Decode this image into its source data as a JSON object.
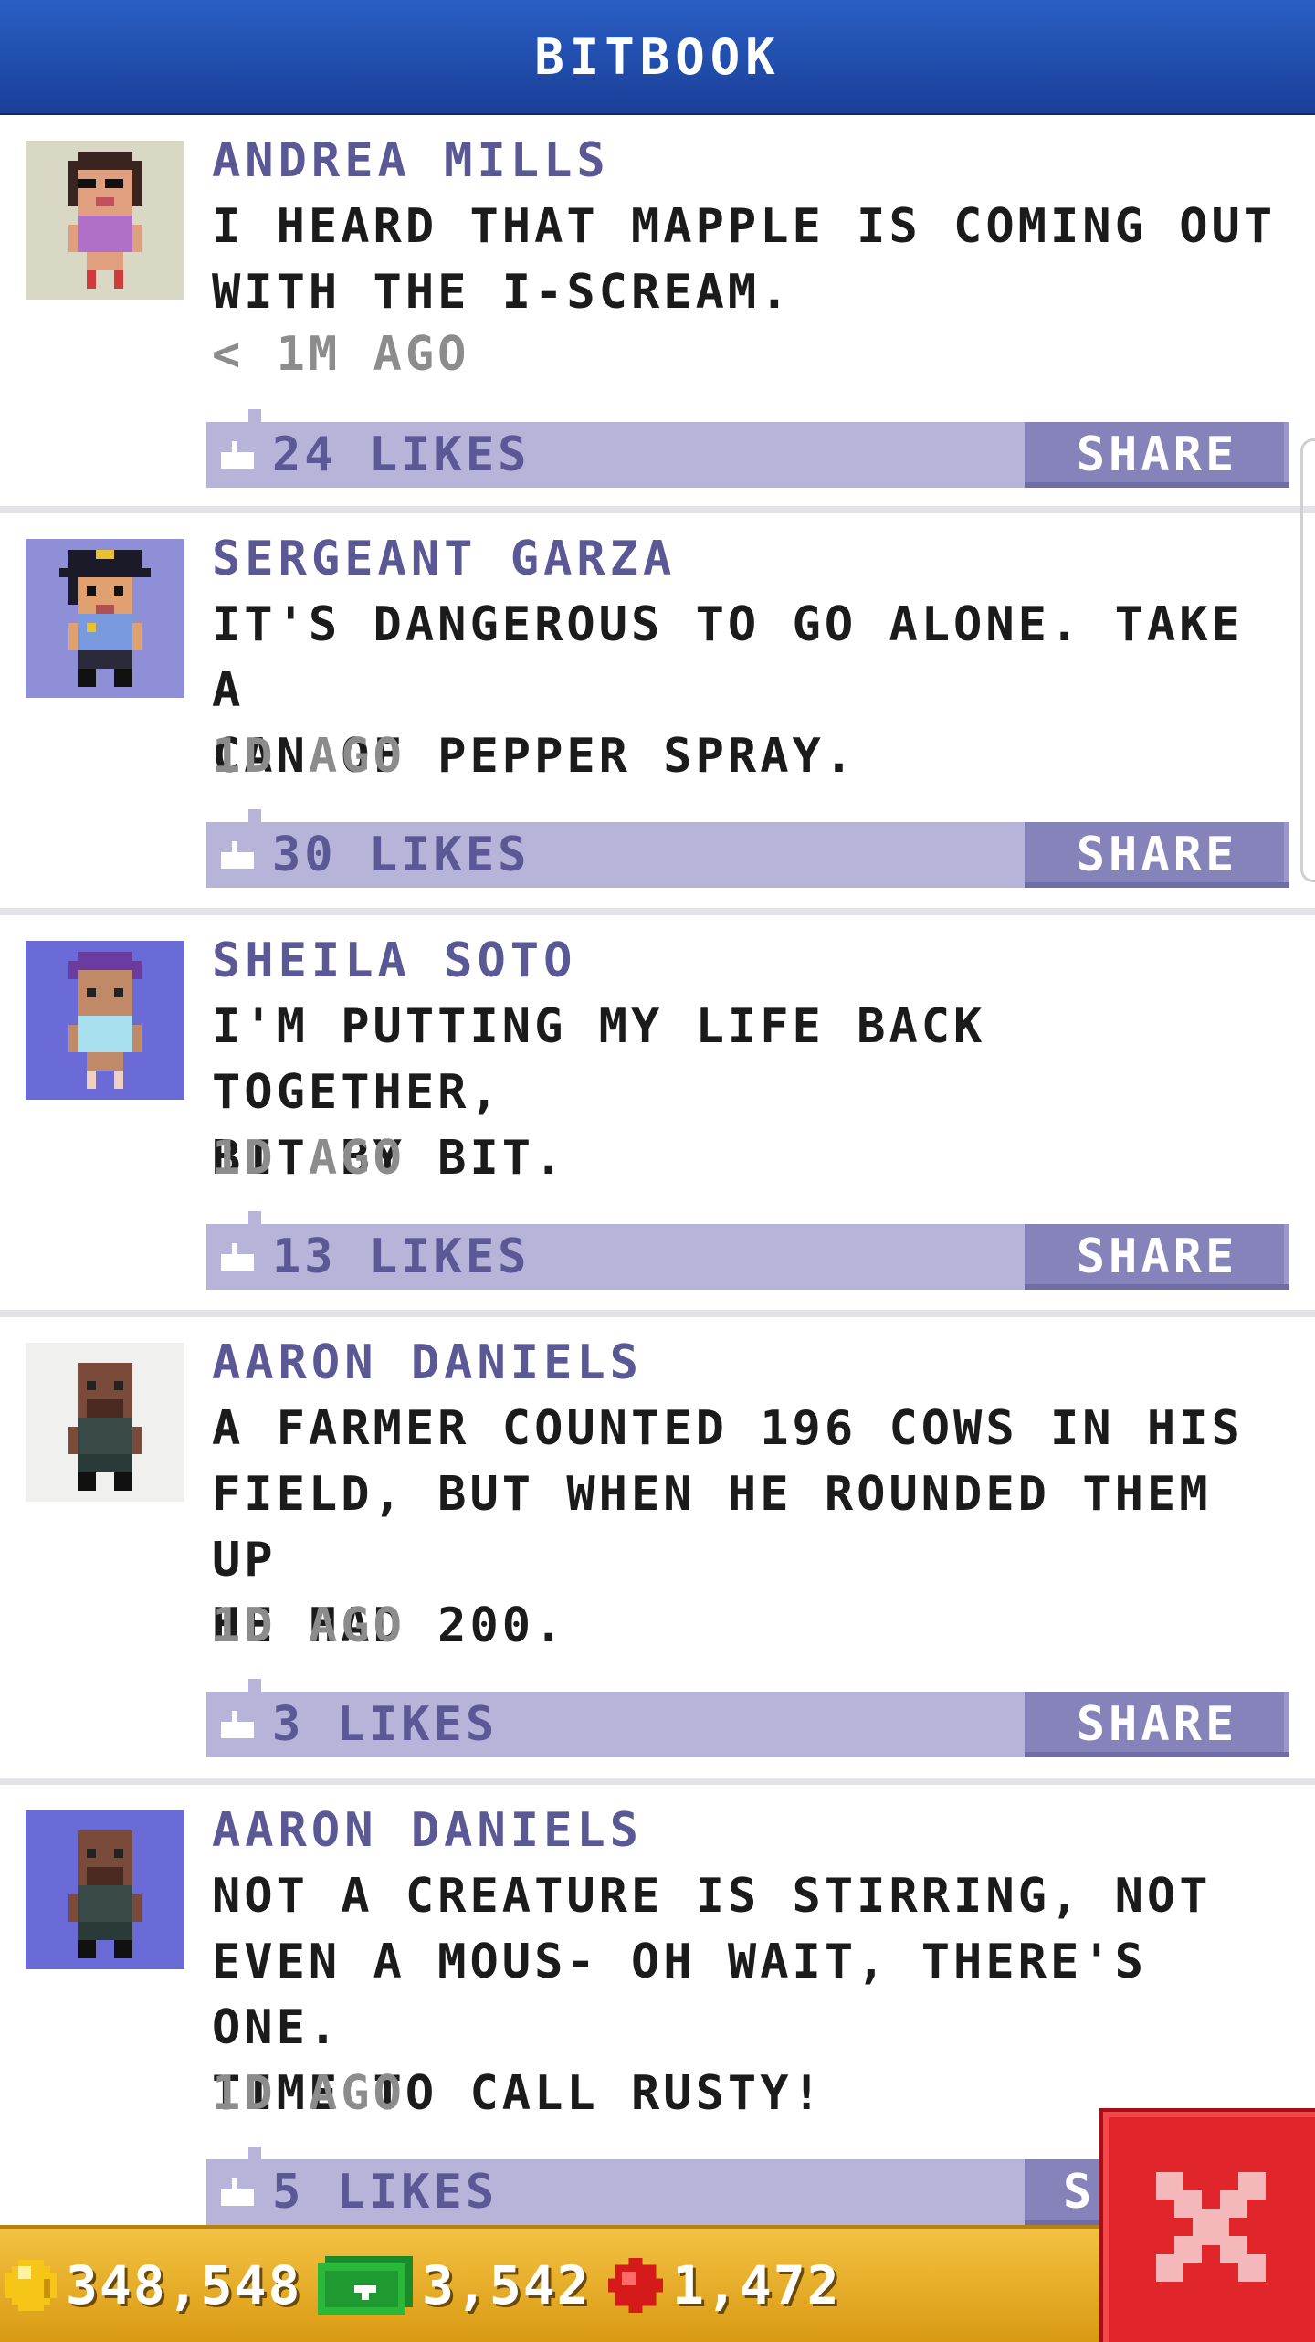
{
  "header": {
    "title": "BITBOOK"
  },
  "posts": [
    {
      "name": "ANDREA MILLS",
      "message": "I HEARD THAT MAPPLE IS COMING OUT\nWITH THE I-SCREAM.",
      "time": "< 1M AGO",
      "likes": "24 LIKES",
      "share": "SHARE",
      "avatar_bg": "#d8d8c4"
    },
    {
      "name": "SERGEANT GARZA",
      "message": "IT'S DANGEROUS TO GO ALONE. TAKE A\nCAN OF PEPPER SPRAY.",
      "time": "1D AGO",
      "likes": "30 LIKES",
      "share": "SHARE",
      "avatar_bg": "#8f8fd8"
    },
    {
      "name": "SHEILA SOTO",
      "message": "I'M PUTTING MY LIFE BACK TOGETHER,\nBIT BY BIT.",
      "time": "1D AGO",
      "likes": "13 LIKES",
      "share": "SHARE",
      "avatar_bg": "#6b6bd8"
    },
    {
      "name": "AARON DANIELS",
      "message": "A FARMER COUNTED 196 COWS IN HIS\nFIELD, BUT WHEN HE ROUNDED THEM UP\nHE HAD 200.",
      "time": "1D AGO",
      "likes": "3 LIKES",
      "share": "SHARE",
      "avatar_bg": "#f0f0ee"
    },
    {
      "name": "AARON DANIELS",
      "message": "NOT A CREATURE IS STIRRING, NOT\nEVEN A MOUS- OH WAIT, THERE'S ONE.\nTIME TO CALL RUSTY!",
      "time": "1D AGO",
      "likes": "5 LIKES",
      "share": "S",
      "avatar_bg": "#6b6bd8"
    }
  ],
  "footer": {
    "coins": "348,548",
    "bux": "3,542",
    "gems": "1,472"
  },
  "colors": {
    "header": "#1f4aac",
    "accent": "#5a5895",
    "bar": "#b6b4d8",
    "share": "#8583b9",
    "footer": "#e8ac22",
    "close": "#e0252b"
  }
}
